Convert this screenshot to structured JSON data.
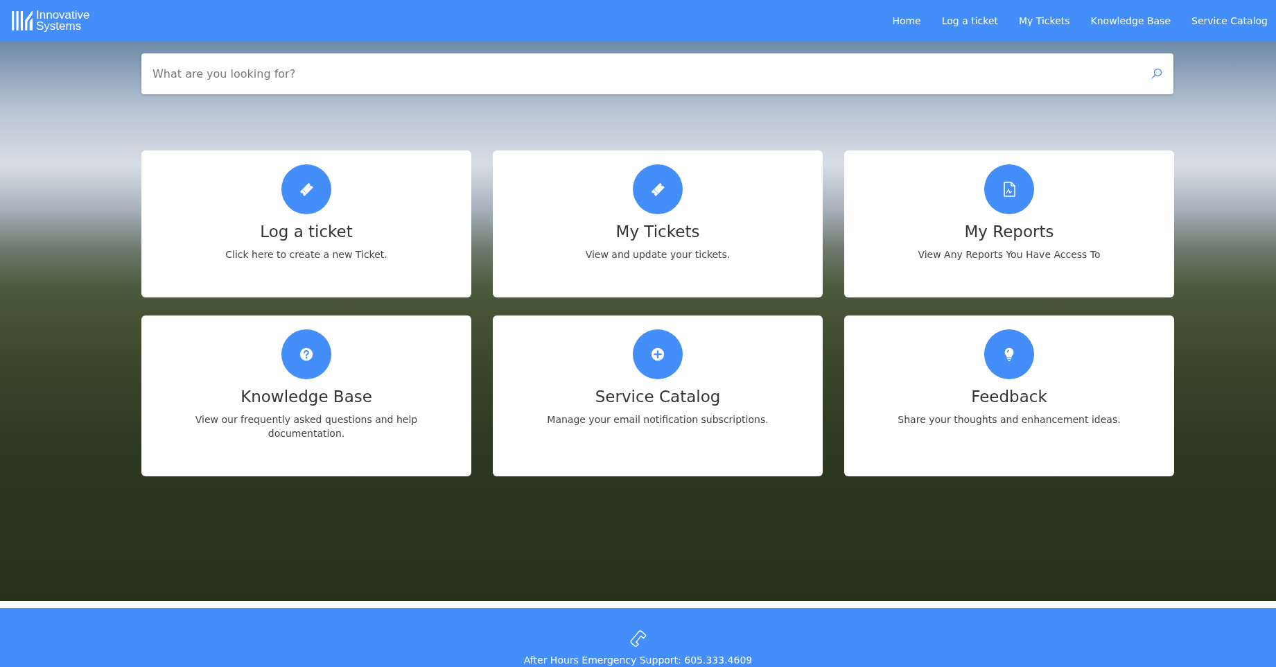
{
  "logo": {
    "line_1": "Innovative",
    "line_2": "Systems"
  },
  "nav": [
    "Home",
    "Log a ticket",
    "My Tickets",
    "Knowledge Base",
    "Service Catalog"
  ],
  "search": {
    "placeholder": "What are you looking for?"
  },
  "cards": [
    {
      "kind": "ticket",
      "title": "Log a ticket",
      "description": "Click here to create a new Ticket."
    },
    {
      "kind": "ticket",
      "title": "My Tickets",
      "description": "View and update your tickets."
    },
    {
      "kind": "report",
      "title": "My Reports",
      "description": "View Any Reports You Have Access To"
    },
    {
      "kind": "question",
      "title": "Knowledge Base",
      "description": "View our frequently asked questions and help documentation."
    },
    {
      "kind": "plus",
      "title": "Service Catalog",
      "description": "Manage your email notification subscriptions."
    },
    {
      "kind": "bulb",
      "title": "Feedback",
      "description": "Share your thoughts and enhancement ideas."
    }
  ],
  "footer": {
    "text": "After Hours Emergency Support: 605.333.4609"
  }
}
